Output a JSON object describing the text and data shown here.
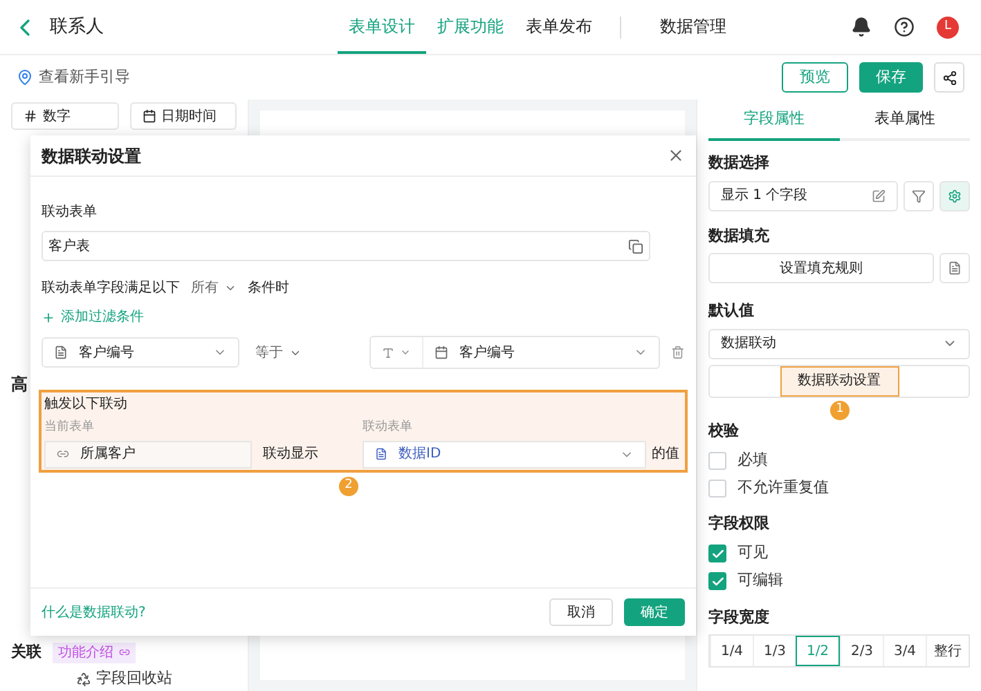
{
  "header": {
    "title": "联系人",
    "tabs": [
      {
        "label": "表单设计",
        "selected": true,
        "highlighted": true
      },
      {
        "label": "扩展功能",
        "selected": false,
        "highlighted": true
      },
      {
        "label": "表单发布",
        "selected": false,
        "highlighted": false
      },
      {
        "label": "数据管理",
        "selected": false,
        "highlighted": false
      }
    ],
    "avatar": "L"
  },
  "toolbar": {
    "guide": "查看新手引导",
    "preview": "预览",
    "save": "保存"
  },
  "left_panel": {
    "fields": [
      "数字",
      "日期时间"
    ],
    "section": "高",
    "footer": {
      "title": "关联",
      "link": "功能介绍",
      "recycle": "字段回收站"
    }
  },
  "dialog": {
    "title": "数据联动设置",
    "form_label": "联动表单",
    "form_value": "客户表",
    "condition_prefix": "联动表单字段满足以下",
    "condition_mode": "所有",
    "condition_suffix": "条件时",
    "add_filter": "添加过滤条件",
    "filter": {
      "field": "客户编号",
      "operator": "等于",
      "target": "客户编号"
    },
    "trigger": {
      "title": "触发以下联动",
      "current_label": "当前表单",
      "linked_label": "联动表单",
      "current_field": "所属客户",
      "action": "联动显示",
      "linked_field": "数据ID",
      "suffix": "的值"
    },
    "marker": "2",
    "help": "什么是数据联动?",
    "cancel": "取消",
    "ok": "确定"
  },
  "right_panel": {
    "tabs": [
      {
        "label": "字段属性",
        "selected": true
      },
      {
        "label": "表单属性",
        "selected": false
      }
    ],
    "data_select": {
      "label": "数据选择",
      "value": "显示 1 个字段"
    },
    "data_fill": {
      "label": "数据填充",
      "button": "设置填充规则"
    },
    "default": {
      "label": "默认值",
      "value": "数据联动",
      "button": "数据联动设置",
      "marker": "1"
    },
    "validation": {
      "label": "校验",
      "options": [
        {
          "label": "必填",
          "checked": false
        },
        {
          "label": "不允许重复值",
          "checked": false
        }
      ]
    },
    "permissions": {
      "label": "字段权限",
      "options": [
        {
          "label": "可见",
          "checked": true
        },
        {
          "label": "可编辑",
          "checked": true
        }
      ]
    },
    "width": {
      "label": "字段宽度",
      "options": [
        {
          "label": "1/4",
          "selected": false
        },
        {
          "label": "1/3",
          "selected": false
        },
        {
          "label": "1/2",
          "selected": true
        },
        {
          "label": "2/3",
          "selected": false
        },
        {
          "label": "3/4",
          "selected": false
        },
        {
          "label": "整行",
          "selected": false
        }
      ]
    }
  }
}
